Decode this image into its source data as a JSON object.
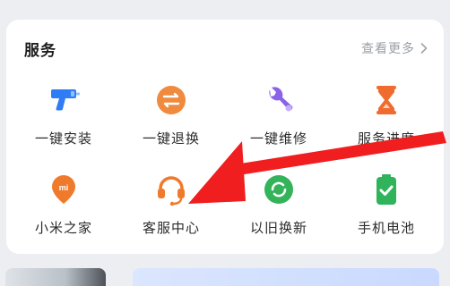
{
  "services": {
    "title": "服务",
    "view_more": "查看更多",
    "items": [
      {
        "label": "一键安装",
        "icon": "drill-icon",
        "color": "#2f7df6"
      },
      {
        "label": "一键退换",
        "icon": "exchange-icon",
        "color": "#f08a3e"
      },
      {
        "label": "一键维修",
        "icon": "wrench-icon",
        "color": "#8a63e8"
      },
      {
        "label": "服务进度",
        "icon": "hourglass-icon",
        "color": "#f06b2e"
      },
      {
        "label": "小米之家",
        "icon": "mi-home-pin-icon",
        "color": "#f07a2c"
      },
      {
        "label": "客服中心",
        "icon": "headset-icon",
        "color": "#f07a2c"
      },
      {
        "label": "以旧换新",
        "icon": "recycle-icon",
        "color": "#34b35a"
      },
      {
        "label": "手机电池",
        "icon": "battery-icon",
        "color": "#2fb45c"
      }
    ]
  },
  "annotation": {
    "color": "#f01e1e"
  }
}
